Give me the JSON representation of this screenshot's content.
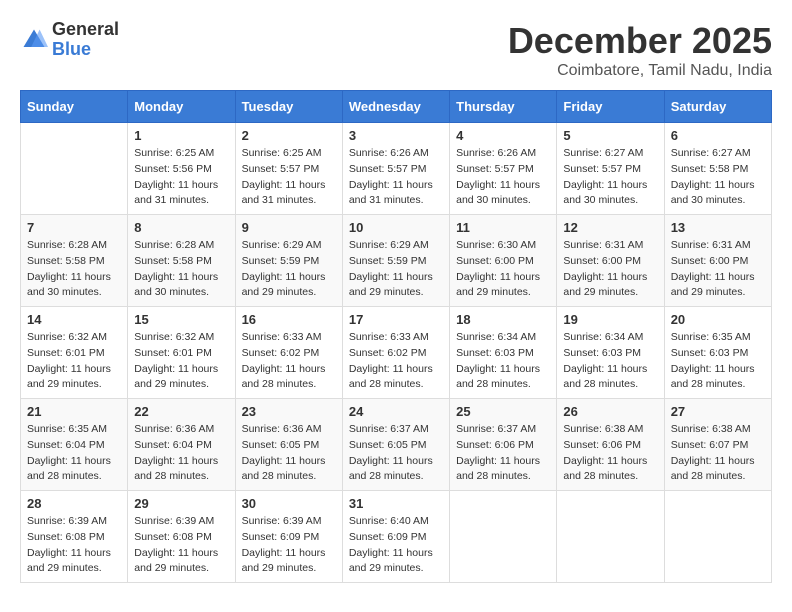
{
  "header": {
    "logo_general": "General",
    "logo_blue": "Blue",
    "month_title": "December 2025",
    "location": "Coimbatore, Tamil Nadu, India"
  },
  "days_of_week": [
    "Sunday",
    "Monday",
    "Tuesday",
    "Wednesday",
    "Thursday",
    "Friday",
    "Saturday"
  ],
  "weeks": [
    [
      {
        "day": "",
        "info": ""
      },
      {
        "day": "1",
        "info": "Sunrise: 6:25 AM\nSunset: 5:56 PM\nDaylight: 11 hours\nand 31 minutes."
      },
      {
        "day": "2",
        "info": "Sunrise: 6:25 AM\nSunset: 5:57 PM\nDaylight: 11 hours\nand 31 minutes."
      },
      {
        "day": "3",
        "info": "Sunrise: 6:26 AM\nSunset: 5:57 PM\nDaylight: 11 hours\nand 31 minutes."
      },
      {
        "day": "4",
        "info": "Sunrise: 6:26 AM\nSunset: 5:57 PM\nDaylight: 11 hours\nand 30 minutes."
      },
      {
        "day": "5",
        "info": "Sunrise: 6:27 AM\nSunset: 5:57 PM\nDaylight: 11 hours\nand 30 minutes."
      },
      {
        "day": "6",
        "info": "Sunrise: 6:27 AM\nSunset: 5:58 PM\nDaylight: 11 hours\nand 30 minutes."
      }
    ],
    [
      {
        "day": "7",
        "info": "Sunrise: 6:28 AM\nSunset: 5:58 PM\nDaylight: 11 hours\nand 30 minutes."
      },
      {
        "day": "8",
        "info": "Sunrise: 6:28 AM\nSunset: 5:58 PM\nDaylight: 11 hours\nand 30 minutes."
      },
      {
        "day": "9",
        "info": "Sunrise: 6:29 AM\nSunset: 5:59 PM\nDaylight: 11 hours\nand 29 minutes."
      },
      {
        "day": "10",
        "info": "Sunrise: 6:29 AM\nSunset: 5:59 PM\nDaylight: 11 hours\nand 29 minutes."
      },
      {
        "day": "11",
        "info": "Sunrise: 6:30 AM\nSunset: 6:00 PM\nDaylight: 11 hours\nand 29 minutes."
      },
      {
        "day": "12",
        "info": "Sunrise: 6:31 AM\nSunset: 6:00 PM\nDaylight: 11 hours\nand 29 minutes."
      },
      {
        "day": "13",
        "info": "Sunrise: 6:31 AM\nSunset: 6:00 PM\nDaylight: 11 hours\nand 29 minutes."
      }
    ],
    [
      {
        "day": "14",
        "info": "Sunrise: 6:32 AM\nSunset: 6:01 PM\nDaylight: 11 hours\nand 29 minutes."
      },
      {
        "day": "15",
        "info": "Sunrise: 6:32 AM\nSunset: 6:01 PM\nDaylight: 11 hours\nand 29 minutes."
      },
      {
        "day": "16",
        "info": "Sunrise: 6:33 AM\nSunset: 6:02 PM\nDaylight: 11 hours\nand 28 minutes."
      },
      {
        "day": "17",
        "info": "Sunrise: 6:33 AM\nSunset: 6:02 PM\nDaylight: 11 hours\nand 28 minutes."
      },
      {
        "day": "18",
        "info": "Sunrise: 6:34 AM\nSunset: 6:03 PM\nDaylight: 11 hours\nand 28 minutes."
      },
      {
        "day": "19",
        "info": "Sunrise: 6:34 AM\nSunset: 6:03 PM\nDaylight: 11 hours\nand 28 minutes."
      },
      {
        "day": "20",
        "info": "Sunrise: 6:35 AM\nSunset: 6:03 PM\nDaylight: 11 hours\nand 28 minutes."
      }
    ],
    [
      {
        "day": "21",
        "info": "Sunrise: 6:35 AM\nSunset: 6:04 PM\nDaylight: 11 hours\nand 28 minutes."
      },
      {
        "day": "22",
        "info": "Sunrise: 6:36 AM\nSunset: 6:04 PM\nDaylight: 11 hours\nand 28 minutes."
      },
      {
        "day": "23",
        "info": "Sunrise: 6:36 AM\nSunset: 6:05 PM\nDaylight: 11 hours\nand 28 minutes."
      },
      {
        "day": "24",
        "info": "Sunrise: 6:37 AM\nSunset: 6:05 PM\nDaylight: 11 hours\nand 28 minutes."
      },
      {
        "day": "25",
        "info": "Sunrise: 6:37 AM\nSunset: 6:06 PM\nDaylight: 11 hours\nand 28 minutes."
      },
      {
        "day": "26",
        "info": "Sunrise: 6:38 AM\nSunset: 6:06 PM\nDaylight: 11 hours\nand 28 minutes."
      },
      {
        "day": "27",
        "info": "Sunrise: 6:38 AM\nSunset: 6:07 PM\nDaylight: 11 hours\nand 28 minutes."
      }
    ],
    [
      {
        "day": "28",
        "info": "Sunrise: 6:39 AM\nSunset: 6:08 PM\nDaylight: 11 hours\nand 29 minutes."
      },
      {
        "day": "29",
        "info": "Sunrise: 6:39 AM\nSunset: 6:08 PM\nDaylight: 11 hours\nand 29 minutes."
      },
      {
        "day": "30",
        "info": "Sunrise: 6:39 AM\nSunset: 6:09 PM\nDaylight: 11 hours\nand 29 minutes."
      },
      {
        "day": "31",
        "info": "Sunrise: 6:40 AM\nSunset: 6:09 PM\nDaylight: 11 hours\nand 29 minutes."
      },
      {
        "day": "",
        "info": ""
      },
      {
        "day": "",
        "info": ""
      },
      {
        "day": "",
        "info": ""
      }
    ]
  ]
}
